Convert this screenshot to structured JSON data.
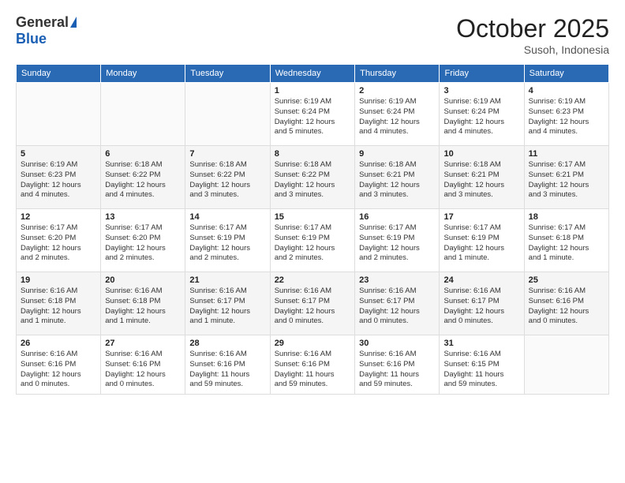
{
  "header": {
    "logo_general": "General",
    "logo_blue": "Blue",
    "month_title": "October 2025",
    "location": "Susoh, Indonesia"
  },
  "weekdays": [
    "Sunday",
    "Monday",
    "Tuesday",
    "Wednesday",
    "Thursday",
    "Friday",
    "Saturday"
  ],
  "weeks": [
    [
      {
        "day": "",
        "info": ""
      },
      {
        "day": "",
        "info": ""
      },
      {
        "day": "",
        "info": ""
      },
      {
        "day": "1",
        "info": "Sunrise: 6:19 AM\nSunset: 6:24 PM\nDaylight: 12 hours\nand 5 minutes."
      },
      {
        "day": "2",
        "info": "Sunrise: 6:19 AM\nSunset: 6:24 PM\nDaylight: 12 hours\nand 4 minutes."
      },
      {
        "day": "3",
        "info": "Sunrise: 6:19 AM\nSunset: 6:24 PM\nDaylight: 12 hours\nand 4 minutes."
      },
      {
        "day": "4",
        "info": "Sunrise: 6:19 AM\nSunset: 6:23 PM\nDaylight: 12 hours\nand 4 minutes."
      }
    ],
    [
      {
        "day": "5",
        "info": "Sunrise: 6:19 AM\nSunset: 6:23 PM\nDaylight: 12 hours\nand 4 minutes."
      },
      {
        "day": "6",
        "info": "Sunrise: 6:18 AM\nSunset: 6:22 PM\nDaylight: 12 hours\nand 4 minutes."
      },
      {
        "day": "7",
        "info": "Sunrise: 6:18 AM\nSunset: 6:22 PM\nDaylight: 12 hours\nand 3 minutes."
      },
      {
        "day": "8",
        "info": "Sunrise: 6:18 AM\nSunset: 6:22 PM\nDaylight: 12 hours\nand 3 minutes."
      },
      {
        "day": "9",
        "info": "Sunrise: 6:18 AM\nSunset: 6:21 PM\nDaylight: 12 hours\nand 3 minutes."
      },
      {
        "day": "10",
        "info": "Sunrise: 6:18 AM\nSunset: 6:21 PM\nDaylight: 12 hours\nand 3 minutes."
      },
      {
        "day": "11",
        "info": "Sunrise: 6:17 AM\nSunset: 6:21 PM\nDaylight: 12 hours\nand 3 minutes."
      }
    ],
    [
      {
        "day": "12",
        "info": "Sunrise: 6:17 AM\nSunset: 6:20 PM\nDaylight: 12 hours\nand 2 minutes."
      },
      {
        "day": "13",
        "info": "Sunrise: 6:17 AM\nSunset: 6:20 PM\nDaylight: 12 hours\nand 2 minutes."
      },
      {
        "day": "14",
        "info": "Sunrise: 6:17 AM\nSunset: 6:19 PM\nDaylight: 12 hours\nand 2 minutes."
      },
      {
        "day": "15",
        "info": "Sunrise: 6:17 AM\nSunset: 6:19 PM\nDaylight: 12 hours\nand 2 minutes."
      },
      {
        "day": "16",
        "info": "Sunrise: 6:17 AM\nSunset: 6:19 PM\nDaylight: 12 hours\nand 2 minutes."
      },
      {
        "day": "17",
        "info": "Sunrise: 6:17 AM\nSunset: 6:19 PM\nDaylight: 12 hours\nand 1 minute."
      },
      {
        "day": "18",
        "info": "Sunrise: 6:17 AM\nSunset: 6:18 PM\nDaylight: 12 hours\nand 1 minute."
      }
    ],
    [
      {
        "day": "19",
        "info": "Sunrise: 6:16 AM\nSunset: 6:18 PM\nDaylight: 12 hours\nand 1 minute."
      },
      {
        "day": "20",
        "info": "Sunrise: 6:16 AM\nSunset: 6:18 PM\nDaylight: 12 hours\nand 1 minute."
      },
      {
        "day": "21",
        "info": "Sunrise: 6:16 AM\nSunset: 6:17 PM\nDaylight: 12 hours\nand 1 minute."
      },
      {
        "day": "22",
        "info": "Sunrise: 6:16 AM\nSunset: 6:17 PM\nDaylight: 12 hours\nand 0 minutes."
      },
      {
        "day": "23",
        "info": "Sunrise: 6:16 AM\nSunset: 6:17 PM\nDaylight: 12 hours\nand 0 minutes."
      },
      {
        "day": "24",
        "info": "Sunrise: 6:16 AM\nSunset: 6:17 PM\nDaylight: 12 hours\nand 0 minutes."
      },
      {
        "day": "25",
        "info": "Sunrise: 6:16 AM\nSunset: 6:16 PM\nDaylight: 12 hours\nand 0 minutes."
      }
    ],
    [
      {
        "day": "26",
        "info": "Sunrise: 6:16 AM\nSunset: 6:16 PM\nDaylight: 12 hours\nand 0 minutes."
      },
      {
        "day": "27",
        "info": "Sunrise: 6:16 AM\nSunset: 6:16 PM\nDaylight: 12 hours\nand 0 minutes."
      },
      {
        "day": "28",
        "info": "Sunrise: 6:16 AM\nSunset: 6:16 PM\nDaylight: 11 hours\nand 59 minutes."
      },
      {
        "day": "29",
        "info": "Sunrise: 6:16 AM\nSunset: 6:16 PM\nDaylight: 11 hours\nand 59 minutes."
      },
      {
        "day": "30",
        "info": "Sunrise: 6:16 AM\nSunset: 6:16 PM\nDaylight: 11 hours\nand 59 minutes."
      },
      {
        "day": "31",
        "info": "Sunrise: 6:16 AM\nSunset: 6:15 PM\nDaylight: 11 hours\nand 59 minutes."
      },
      {
        "day": "",
        "info": ""
      }
    ]
  ]
}
